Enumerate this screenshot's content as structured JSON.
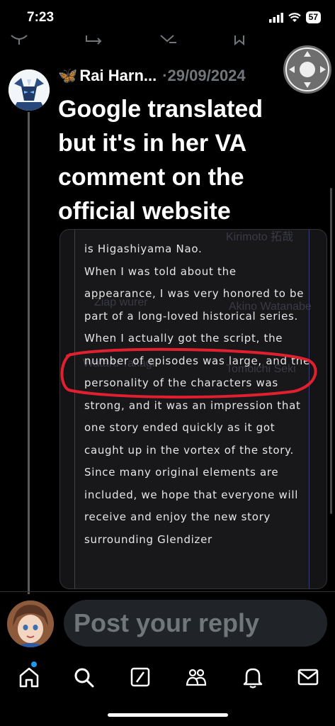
{
  "status_bar": {
    "time": "7:23",
    "battery": "57"
  },
  "post": {
    "author_emoji": "🦋",
    "author_name": "Rai Harn...",
    "separator": "·",
    "date": "29/09/2024",
    "text": "Google translated but it's in her VA comment on the official website"
  },
  "media": {
    "translated_text": "is Higashiyama Nao.\nWhen I was told about the appearance, I was very honored to be part of a long-loved historical series.\nWhen I actually got the script, the number of episodes was large, and the personality of the characters was strong, and it was an impression that one story ended quickly as it got caught up in the vortex of the story.\nSince many original elements are included, we hope that everyone will receive and enjoy the new story surrounding Glendizer",
    "faint_names": [
      "Kirimoto 拓哉",
      "Ziap wurer",
      "Akino Watanabe",
      "Wataru Takagi",
      "Tomoichi Seki"
    ],
    "highlight_color": "#e0202f"
  },
  "reply": {
    "placeholder": "Post your reply"
  },
  "colors": {
    "accent": "#1d9bf0",
    "secondary_text": "#71767b"
  },
  "nav": {
    "items": [
      "home-icon",
      "search-icon",
      "grok-icon",
      "communities-icon",
      "notifications-icon",
      "messages-icon"
    ]
  }
}
